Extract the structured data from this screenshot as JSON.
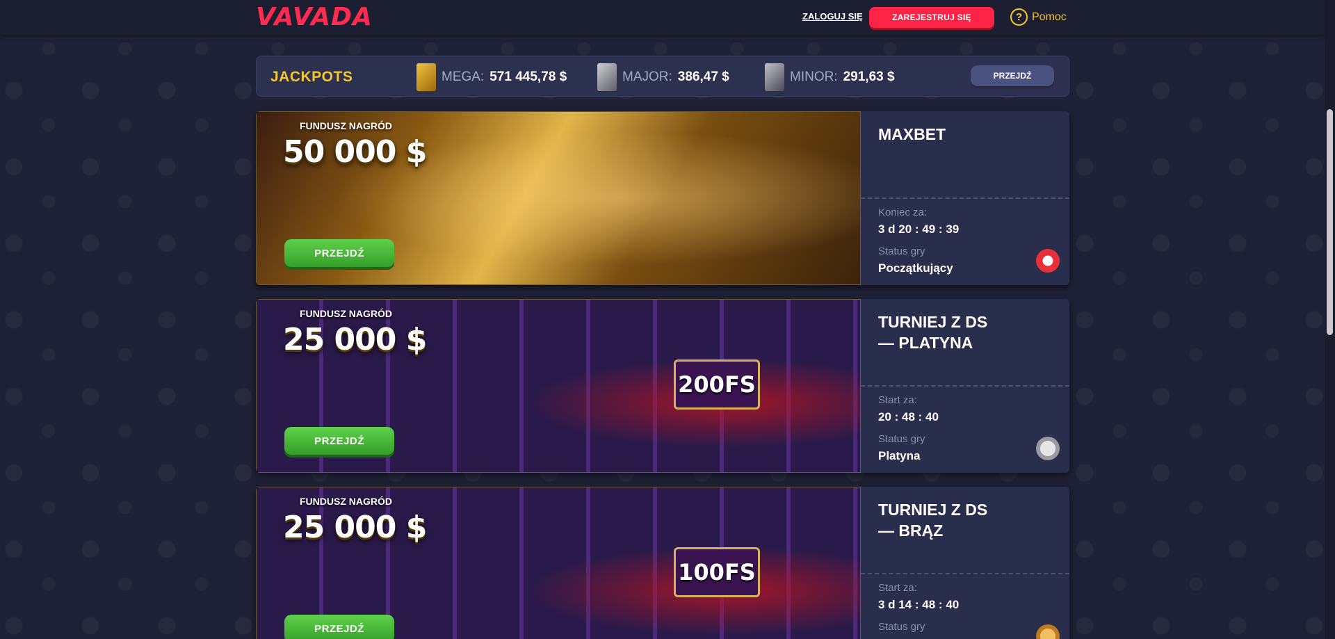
{
  "header": {
    "logo": "VAVADA",
    "login_label": "ZALOGUJ SIĘ",
    "register_label": "ZAREJESTRUJ SIĘ",
    "help_label": "Pomoc",
    "help_icon": "?"
  },
  "jackpots": {
    "title": "JACKPOTS",
    "items": [
      {
        "label": "MEGA:",
        "value": "571 445,78 $"
      },
      {
        "label": "MAJOR:",
        "value": "386,47 $"
      },
      {
        "label": "MINOR:",
        "value": "291,63 $"
      }
    ],
    "go_label": "PRZEJDŹ"
  },
  "tournaments": [
    {
      "fund_label": "FUNDUSZ NAGRÓD",
      "fund_value": "50 000 $",
      "go_label": "PRZEJDŹ",
      "title_line1": "MAXBET",
      "title_line2": "",
      "timer_label": "Koniec za:",
      "timer": "3 d 20 : 49 : 39",
      "status_label": "Status gry",
      "status": "Początkujący",
      "badge": "",
      "status_icon": "beginner-chip"
    },
    {
      "fund_label": "FUNDUSZ NAGRÓD",
      "fund_value": "25 000 $",
      "go_label": "PRZEJDŹ",
      "title_line1": "TURNIEJ Z DS",
      "title_line2": "— PLATYNA",
      "timer_label": "Start za:",
      "timer": "20 : 48 : 40",
      "status_label": "Status gry",
      "status": "Platyna",
      "badge": "200FS",
      "status_icon": "platinum-medal"
    },
    {
      "fund_label": "FUNDUSZ NAGRÓD",
      "fund_value": "25 000 $",
      "go_label": "PRZEJDŹ",
      "title_line1": "TURNIEJ Z DS",
      "title_line2": "— BRĄZ",
      "timer_label": "Start za:",
      "timer": "3 d 14 : 48 : 40",
      "status_label": "Status gry",
      "status": "",
      "badge": "100FS",
      "status_icon": "bronze-medal"
    }
  ]
}
